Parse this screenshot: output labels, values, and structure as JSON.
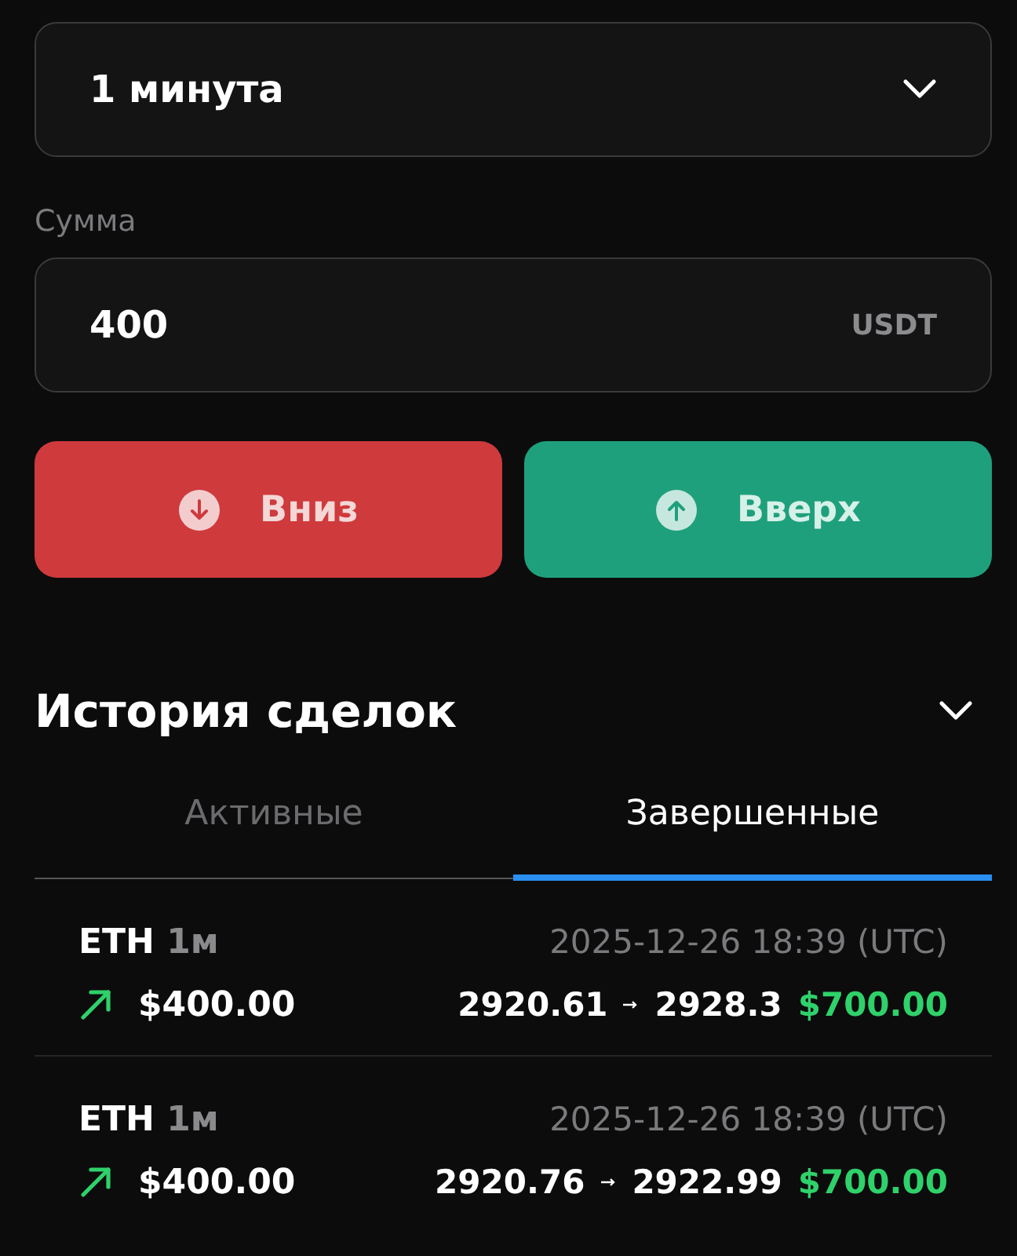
{
  "duration_select": {
    "value": "1 минута"
  },
  "amount": {
    "label": "Сумма",
    "value": "400",
    "unit": "USDT"
  },
  "buttons": [
    {
      "label": "Вниз",
      "kind": "down"
    },
    {
      "label": "Вверх",
      "kind": "up"
    }
  ],
  "history": {
    "title": "История сделок",
    "expanded": true,
    "tabs": [
      {
        "label": "Активные",
        "selected": false
      },
      {
        "label": "Завершенные",
        "selected": true
      }
    ],
    "trades": [
      {
        "asset": "ETH",
        "period": "1м",
        "time": "2025-12-26 18:39 (UTC)",
        "rising": true,
        "stake": "$400.00",
        "open": "2920.61",
        "close": "2928.3",
        "payout": "$700.00"
      },
      {
        "asset": "ETH",
        "period": "1м",
        "time": "2025-12-26 18:39 (UTC)",
        "rising": true,
        "stake": "$400.00",
        "open": "2920.76",
        "close": "2922.99",
        "payout": "$700.00"
      }
    ]
  }
}
